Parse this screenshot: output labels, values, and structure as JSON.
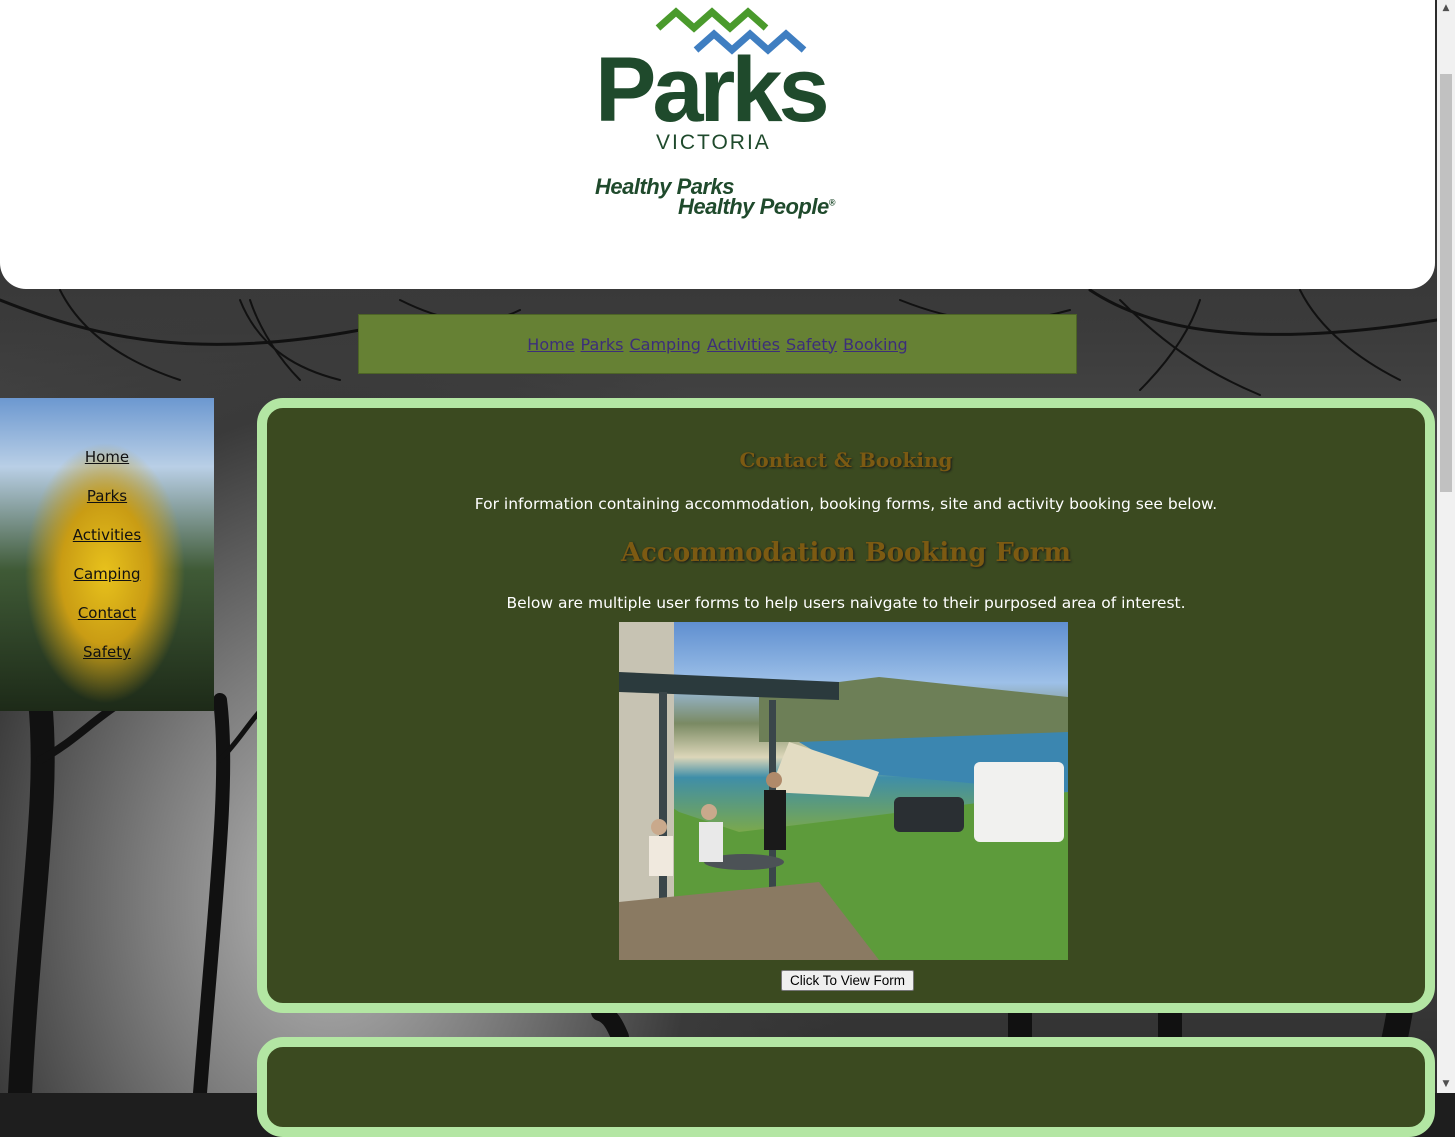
{
  "header": {
    "logo_word": "Parks",
    "logo_sub": "VICTORIA",
    "tagline_1": "Healthy Parks",
    "tagline_2": "Healthy People",
    "tagline_mark": "®"
  },
  "top_nav": {
    "items": [
      "Home",
      "Parks",
      "Camping",
      "Activities",
      "Safety",
      "Booking"
    ]
  },
  "side_nav": {
    "items": [
      "Home",
      "Parks",
      "Activities",
      "Camping",
      "Contact",
      "Safety"
    ]
  },
  "main": {
    "heading": "Contact & Booking",
    "intro": "For information containing accommodation, booking forms, site and activity booking see below.",
    "form_heading": "Accommodation Booking Form",
    "form_text": "Below are multiple user forms to help users naivgate to their purposed area of interest.",
    "button_label": "Click To View Form"
  },
  "colors": {
    "panel_bg": "#3b4a20",
    "panel_border": "#b3e6a3",
    "nav_bg": "#668134",
    "heading": "#7c5a12",
    "logo_green": "#1f4a2c",
    "logo_chevron_green": "#4a9a2c",
    "logo_chevron_blue": "#3f7ec1"
  },
  "icons": {
    "scroll_up": "triangle-up",
    "scroll_down": "triangle-down"
  }
}
